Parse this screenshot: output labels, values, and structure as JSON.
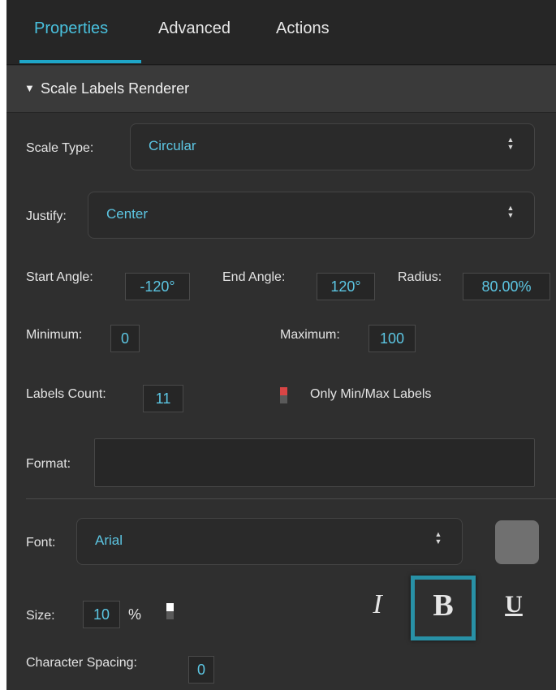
{
  "tabs": [
    {
      "label": "Properties",
      "active": true
    },
    {
      "label": "Advanced",
      "active": false
    },
    {
      "label": "Actions",
      "active": false
    }
  ],
  "section": {
    "caret": "▼",
    "title": "Scale Labels Renderer"
  },
  "scale_type": {
    "label": "Scale Type:",
    "value": "Circular",
    "arrows": "▲▼"
  },
  "justify": {
    "label": "Justify:",
    "value": "Center",
    "arrows": "▲▼"
  },
  "start_angle": {
    "label": "Start Angle:",
    "value": "-120°"
  },
  "end_angle": {
    "label": "End Angle:",
    "value": "120°"
  },
  "radius": {
    "label": "Radius:",
    "value": "80.00%"
  },
  "minimum": {
    "label": "Minimum:",
    "value": "0"
  },
  "maximum": {
    "label": "Maximum:",
    "value": "100"
  },
  "labels_count": {
    "label": "Labels Count:",
    "value": "11"
  },
  "only_min_max": {
    "label": "Only Min/Max Labels",
    "checked": false
  },
  "format": {
    "label": "Format:",
    "value": ""
  },
  "font": {
    "label": "Font:",
    "value": "Arial",
    "arrows": "▲▼",
    "color_swatch": "#707070"
  },
  "size": {
    "label": "Size:",
    "value": "10",
    "unit": "%"
  },
  "text_style": {
    "italic": "I",
    "bold": "B",
    "underline": "U",
    "bold_active": true
  },
  "character_spacing": {
    "label": "Character Spacing:",
    "value": "0"
  },
  "colors": {
    "accent": "#49c1de",
    "panel": "#2f2f2f",
    "highlight": "#2891a6"
  }
}
